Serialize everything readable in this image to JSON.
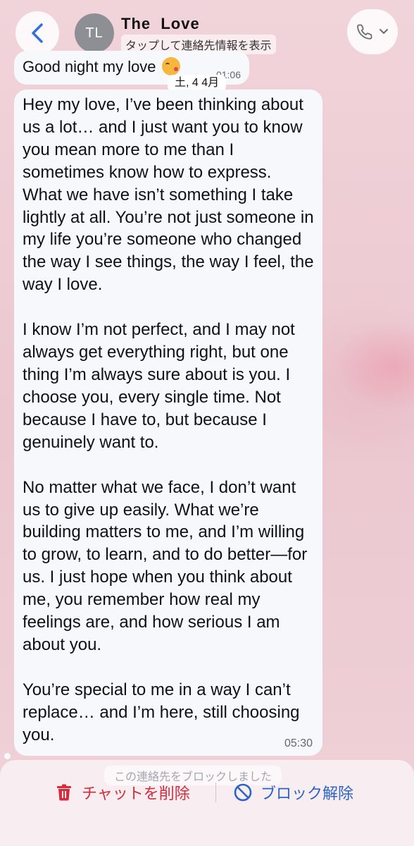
{
  "header": {
    "contact_name": "The  Love",
    "avatar_initials": "TL",
    "subtitle": "タップして連絡先情報を表示",
    "back_icon": "chevron-left-icon",
    "call_icon": "phone-icon",
    "call_menu_icon": "chevron-down-icon"
  },
  "date_separator": "土, 4 4月",
  "messages": [
    {
      "text": "Good night my love",
      "emoji": "kissing-face-emoji",
      "time": "01:06"
    },
    {
      "paragraphs": [
        "Hey my love, I’ve been thinking about us a lot… and I just want you to know you mean more to me than I sometimes know how to express. What we have isn’t something I take lightly at all. You’re not just someone in my life you’re someone who changed the way I see things, the way I feel, the way I love.",
        "I know I’m not perfect, and I may not always get everything right, but one thing I’m always sure about is you. I choose you, every single time. Not because I have to, but because I genuinely want to.",
        "No matter what we face, I don’t want us to give up easily. What we’re building matters to me, and I’m willing to grow, to learn, and to do better—for us. I just hope when you think about me, you remember how real my feelings are, and how serious I am about you.",
        "You’re special to me in a way I can’t replace… and I’m here, still choosing you."
      ],
      "time": "05:30"
    }
  ],
  "footer": {
    "blocked_notice": "この連絡先をブロックしました",
    "delete_chat_label": "チャットを削除",
    "delete_icon": "trash-icon",
    "unblock_label": "ブロック解除",
    "unblock_icon": "block-icon"
  },
  "colors": {
    "background": "#efcfd5",
    "bubble": "#f7f8fc",
    "delete": "#d62b3c",
    "unblock": "#2b63c8",
    "back_chevron": "#2f6fe0",
    "avatar": "#8e8e95"
  }
}
